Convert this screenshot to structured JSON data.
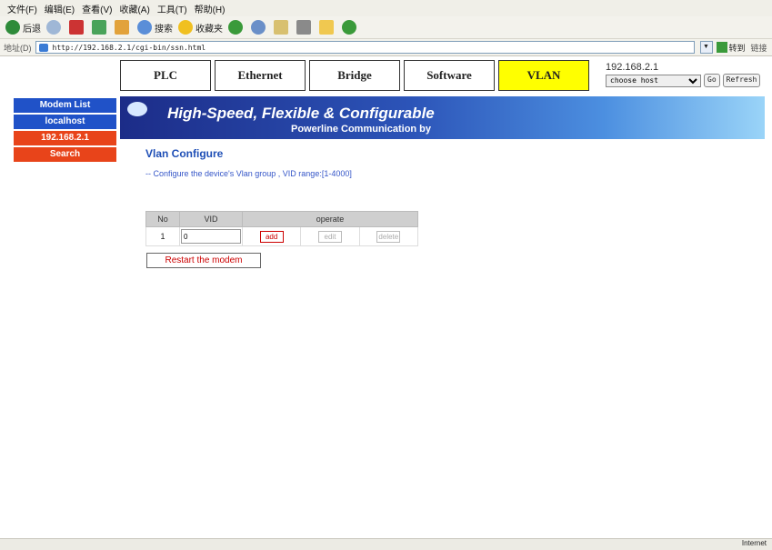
{
  "menubar": {
    "items": [
      "文件(F)",
      "编辑(E)",
      "查看(V)",
      "收藏(A)",
      "工具(T)",
      "帮助(H)"
    ]
  },
  "toolbar": {
    "back": "后退",
    "search": "搜索",
    "favorites": "收藏夹"
  },
  "addressbar": {
    "label": "地址(D)",
    "url": "http://192.168.2.1/cgi-bin/ssn.html",
    "go": "转到",
    "links": "链接"
  },
  "tabs": [
    {
      "label": "PLC",
      "active": false
    },
    {
      "label": "Ethernet",
      "active": false
    },
    {
      "label": "Bridge",
      "active": false
    },
    {
      "label": "Software",
      "active": false
    },
    {
      "label": "VLAN",
      "active": true
    }
  ],
  "host": {
    "ip": "192.168.2.1",
    "select_value": "choose host",
    "go_label": "Go",
    "refresh_label": "Refresh"
  },
  "sidebar": {
    "items": [
      "Modem List",
      "localhost",
      "192.168.2.1",
      "Search"
    ]
  },
  "banner": {
    "slogan": "High-Speed, Flexible & Configurable",
    "subtitle": "Powerline Communication by"
  },
  "main": {
    "title": "Vlan Configure",
    "description": "-- Configure the device's Vlan group , VID range:[1-4000]",
    "table": {
      "headers": [
        "No",
        "VID",
        "operate"
      ],
      "rows": [
        {
          "no": "1",
          "vid": "0",
          "add": "add",
          "edit": "edit",
          "delete": "delete"
        }
      ]
    },
    "restart_label": "Restart the modem"
  },
  "status": {
    "zone": "Internet"
  }
}
